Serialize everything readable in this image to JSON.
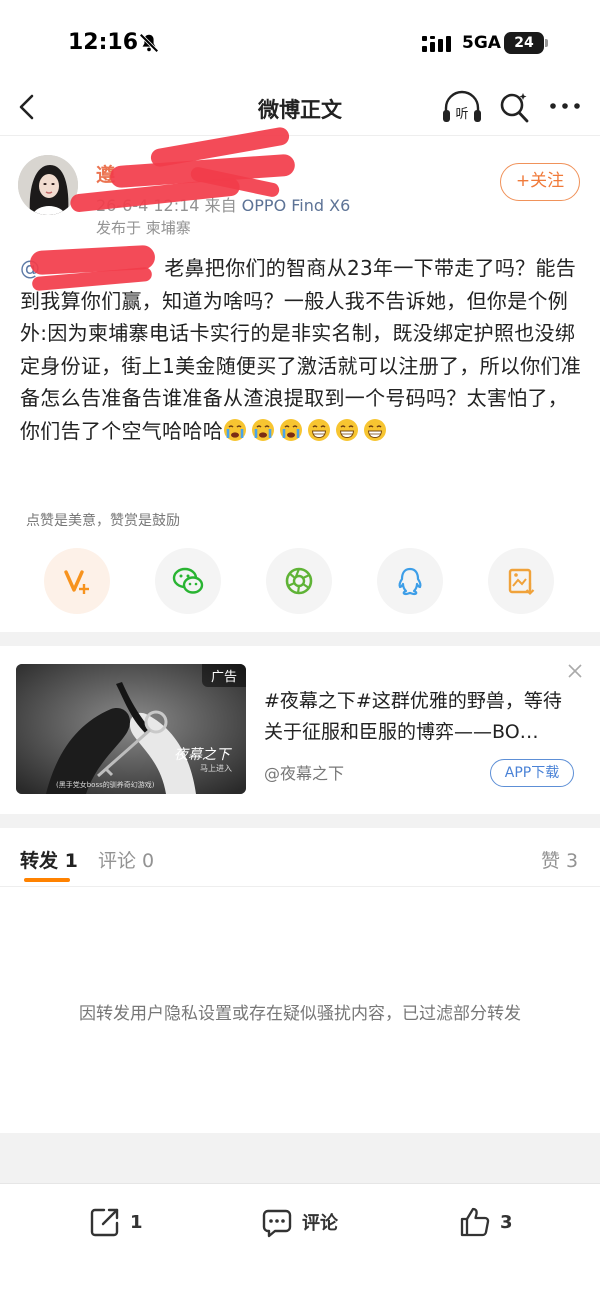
{
  "status_bar": {
    "time": "12:16",
    "network": "5GA",
    "battery": "24"
  },
  "nav": {
    "title": "微博正文"
  },
  "post": {
    "username": "遵",
    "date": "26-6-4 12:14",
    "source_prefix": "来自",
    "device": "OPPO Find X6",
    "location": "发布于 柬埔寨",
    "follow_label": "+关注",
    "mention": "@",
    "text": "老鼻把你们的智商从23年一下带走了吗？能告到我算你们赢，知道为啥吗？一般人我不告诉她，但你是个例外:因为柬埔寨电话卡实行的是非实名制，既没绑定护照也没绑定身份证，街上1美金随便买了激活就可以注册了，所以你们准备怎么告准备告谁准备从渣浪提取到一个号码吗？太害怕了，你们告了个空气哈哈哈",
    "emojis": [
      "crying-emoji",
      "crying-emoji",
      "crying-emoji",
      "grin-emoji",
      "grin-emoji",
      "grin-emoji"
    ]
  },
  "reward_hint": "点赞是美意，赞赏是鼓励",
  "share_buttons": [
    {
      "name": "reward-button",
      "icon": "reward-v-icon",
      "color": "#f7931e"
    },
    {
      "name": "share-wechat-button",
      "icon": "wechat-icon",
      "color": "#29b432"
    },
    {
      "name": "share-moments-button",
      "icon": "moments-icon",
      "color": "#5fb336"
    },
    {
      "name": "share-qq-button",
      "icon": "qq-icon",
      "color": "#3d9ee8"
    },
    {
      "name": "save-image-button",
      "icon": "image-download-icon",
      "color": "#f0a23a"
    }
  ],
  "ad": {
    "tag": "广告",
    "title": "#夜幕之下#这群优雅的野兽，等待关于征服和臣服的博弈——BO…",
    "source": "@夜幕之下",
    "download_label": "APP下载",
    "image_logo": "夜幕之下",
    "image_sub": "马上进入",
    "image_caption": "(黑手党女boss的驯养奇幻游戏)"
  },
  "tabs": {
    "repost": "转发 1",
    "comment": "评论 0",
    "like": "赞 3"
  },
  "filter_note": "因转发用户隐私设置或存在疑似骚扰内容，已过滤部分转发",
  "bottom_bar": {
    "repost_count": "1",
    "comment_label": "评论",
    "like_count": "3"
  }
}
